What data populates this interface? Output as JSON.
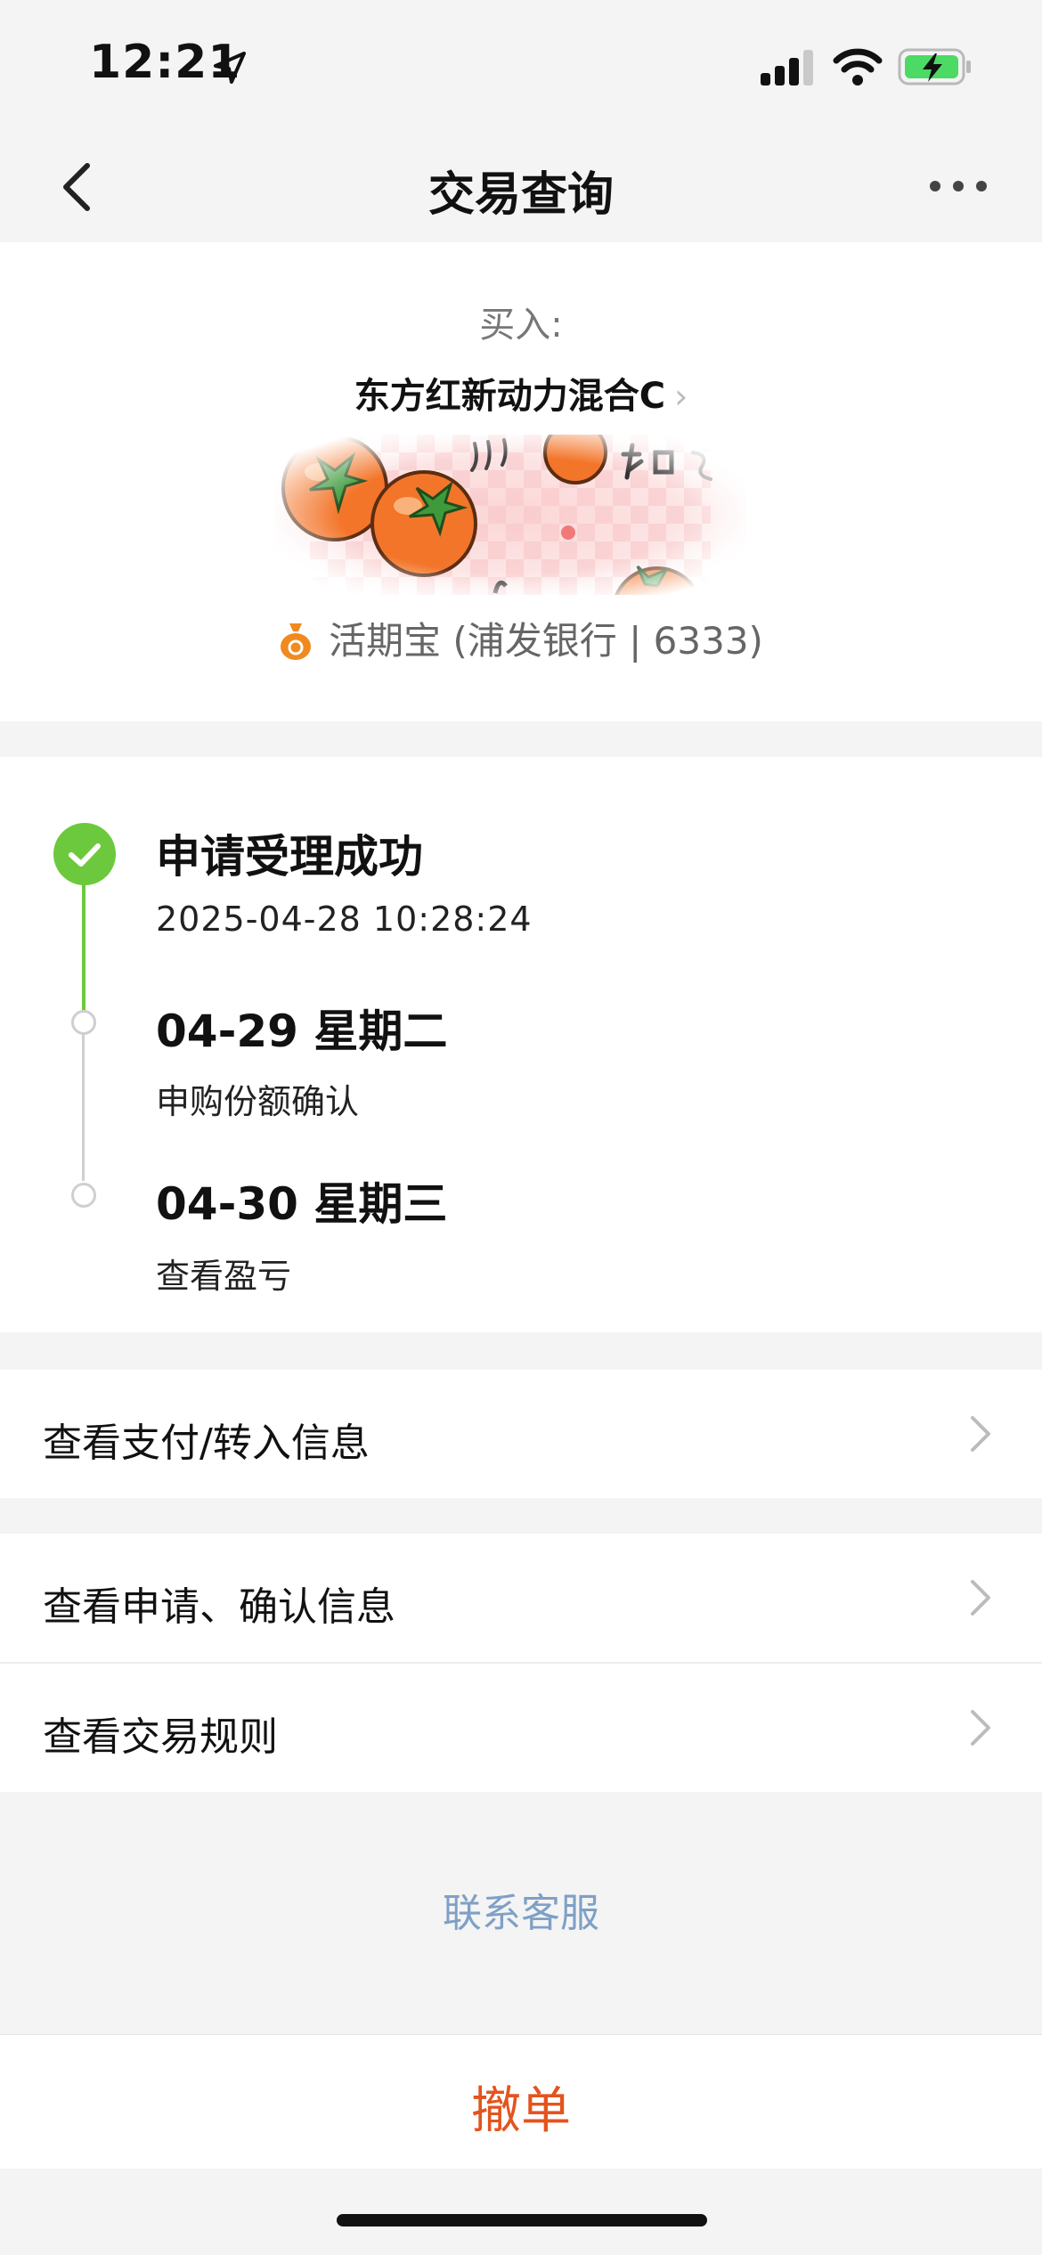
{
  "status_bar": {
    "time": "12:21",
    "icons": [
      "location-arrow-icon",
      "cellular-signal-icon",
      "wifi-icon",
      "battery-charging-icon"
    ]
  },
  "nav": {
    "title": "交易查询",
    "back_icon": "chevron-left-icon",
    "more_icon": "more-dots-icon"
  },
  "order": {
    "action_label": "买入:",
    "fund_name": "东方红新动力混合C",
    "fund_chevron": "›",
    "account": "活期宝 (浦发银行 | 6333)",
    "account_icon": "money-bag-icon"
  },
  "timeline": [
    {
      "title": "申请受理成功",
      "subtitle": "2025-04-28 10:28:24",
      "status": "done"
    },
    {
      "title": "04-29 星期二",
      "subtitle": "申购份额确认",
      "status": "pending"
    },
    {
      "title": "04-30 星期三",
      "subtitle": "查看盈亏",
      "status": "pending"
    }
  ],
  "rows": {
    "payment_info": "查看支付/转入信息",
    "apply_confirm_info": "查看申请、确认信息",
    "trade_rules": "查看交易规则"
  },
  "service_link": "联系客服",
  "cancel_button": "撤单",
  "colors": {
    "success_green": "#6cc93d",
    "link_blue": "#7fa0c6",
    "cancel_orange": "#e3541f",
    "account_icon_orange": "#f08a1e"
  }
}
